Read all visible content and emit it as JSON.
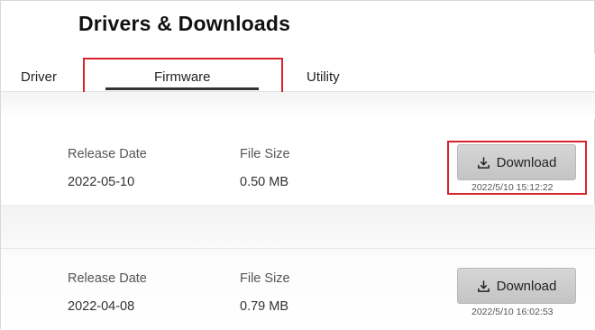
{
  "header": {
    "title": "Drivers & Downloads"
  },
  "tabs": [
    {
      "label": "Driver"
    },
    {
      "label": "Firmware",
      "active": true
    },
    {
      "label": "Utility"
    }
  ],
  "columns": {
    "release_date": "Release Date",
    "file_size": "File Size"
  },
  "downloads": [
    {
      "release_date": "2022-05-10",
      "file_size": "0.50 MB",
      "button_label": "Download",
      "timestamp": "2022/5/10 15:12:22"
    },
    {
      "release_date": "2022-04-08",
      "file_size": "0.79 MB",
      "button_label": "Download",
      "timestamp": "2022/5/10 16:02:53"
    }
  ],
  "colors": {
    "highlight": "#d8232a",
    "button": "#cfcfcf"
  },
  "icons": {
    "download": "download-icon"
  }
}
